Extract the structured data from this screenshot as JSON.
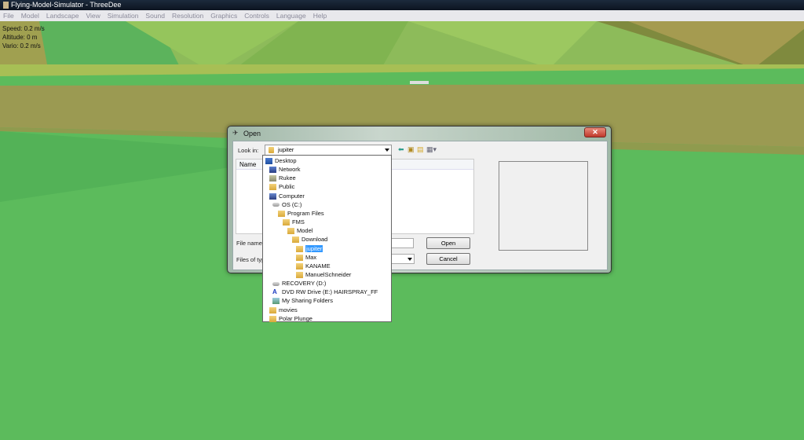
{
  "window": {
    "title": "Flying-Model-Simulator - ThreeDee"
  },
  "menu": [
    "File",
    "Model",
    "Landscape",
    "View",
    "Simulation",
    "Sound",
    "Resolution",
    "Graphics",
    "Controls",
    "Language",
    "Help"
  ],
  "hud": {
    "speed": "Speed: 0.2 m/s",
    "altitude": "Altitude: 0 m",
    "vario": "Vario: 0.2 m/s"
  },
  "dialog": {
    "title": "Open",
    "close": "✕",
    "look_in_label": "Look in:",
    "look_in_value": "jupiter",
    "name_header": "Name",
    "file_name_label": "File name:",
    "files_of_type_label": "Files of typ",
    "open_button": "Open",
    "cancel_button": "Cancel",
    "dropdown_items": [
      {
        "label": "Desktop",
        "icon": "desktop-icon",
        "level": 0
      },
      {
        "label": "Network",
        "icon": "network-icon",
        "level": 1
      },
      {
        "label": "Rukee",
        "icon": "user-folder-icon",
        "level": 1
      },
      {
        "label": "Public",
        "icon": "folder-icon",
        "level": 1
      },
      {
        "label": "Computer",
        "icon": "computer-icon",
        "level": 1
      },
      {
        "label": "OS (C:)",
        "icon": "drive-icon",
        "level": 2
      },
      {
        "label": "Program Files",
        "icon": "folder-icon",
        "level": 3
      },
      {
        "label": "FMS",
        "icon": "folder-icon",
        "level": 4
      },
      {
        "label": "Model",
        "icon": "folder-icon",
        "level": 5
      },
      {
        "label": "Download",
        "icon": "folder-icon",
        "level": 6
      },
      {
        "label": "jupiter",
        "icon": "folder-icon",
        "level": 7,
        "selected": true
      },
      {
        "label": "Max",
        "icon": "folder-icon",
        "level": 7
      },
      {
        "label": "KANAME",
        "icon": "folder-icon",
        "level": 7
      },
      {
        "label": "ManuelSchneider",
        "icon": "folder-icon",
        "level": 7
      },
      {
        "label": "RECOVERY (D:)",
        "icon": "drive-icon",
        "level": 2
      },
      {
        "label": "DVD RW Drive (E:) HAIRSPRAY_FF",
        "icon": "dvd-icon",
        "level": 2
      },
      {
        "label": "My Sharing Folders",
        "icon": "sharing-icon",
        "level": 2
      },
      {
        "label": "movies",
        "icon": "folder-icon",
        "level": 1
      },
      {
        "label": "Polar Plunge",
        "icon": "folder-icon",
        "level": 1
      }
    ]
  },
  "colors": {
    "selection": "#3399ff",
    "close": "#c0392b"
  }
}
